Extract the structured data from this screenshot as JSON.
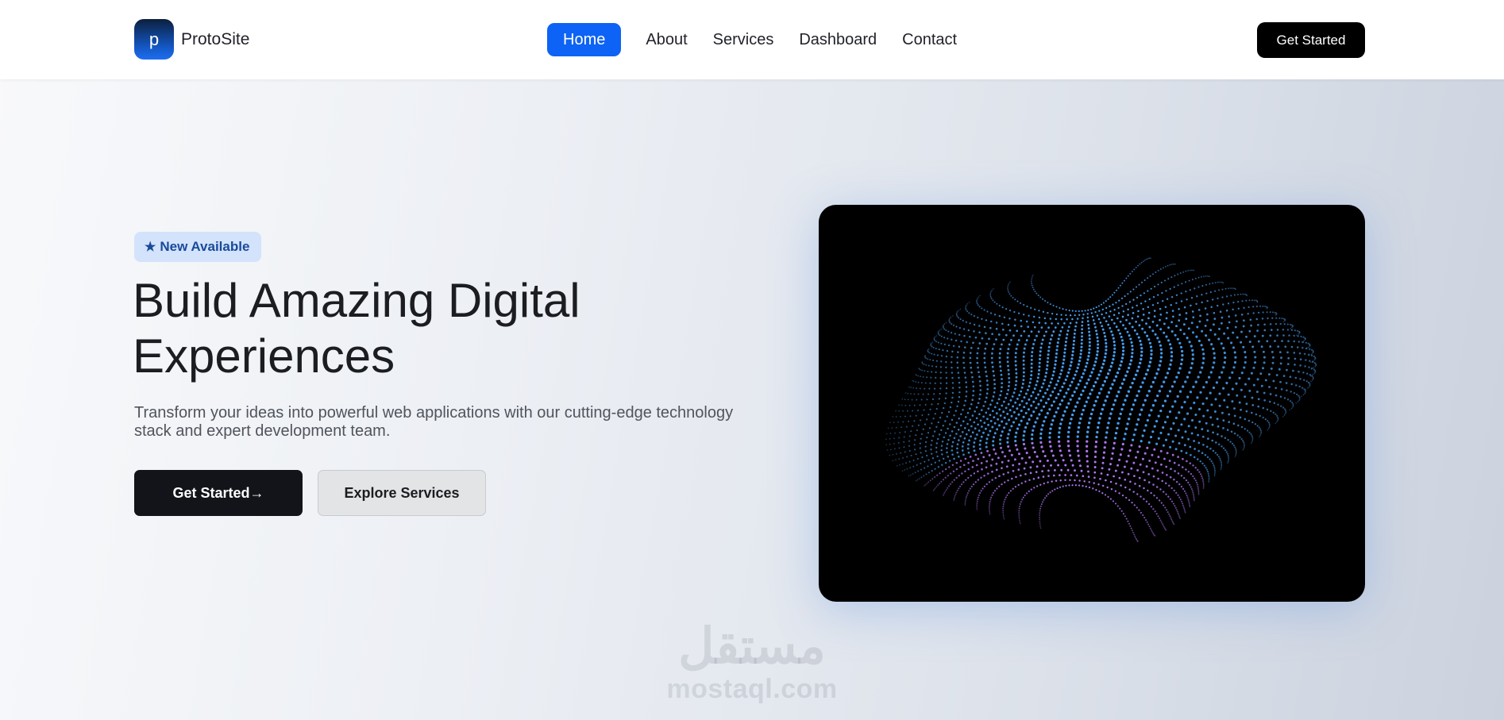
{
  "brand": {
    "logo_letter": "p",
    "name": "ProtoSite"
  },
  "nav": {
    "links": [
      {
        "label": "Home",
        "active": true
      },
      {
        "label": "About"
      },
      {
        "label": "Services"
      },
      {
        "label": "Dashboard"
      },
      {
        "label": "Contact"
      }
    ],
    "cta_label": "Get Started"
  },
  "hero": {
    "badge_icon": "★",
    "badge_label": "New Available",
    "title_line1": "Build Amazing Digital",
    "title_line2": "Experiences",
    "description": "Transform your ideas into powerful web applications with our cutting-edge technology stack and expert development team.",
    "primary_button": "Get Started→",
    "secondary_button": "Explore Services",
    "media_icon": "particle-wave-sphere"
  },
  "watermark": {
    "arabic": "مستقل",
    "latin": "mostaql.com"
  },
  "colors": {
    "accent": "#0d63f5",
    "primary_button": "#121419",
    "badge_bg": "#d3e3fb",
    "badge_text": "#184a9b",
    "particles_main": "#4aa8ff",
    "particles_edge": "#b77cff"
  }
}
